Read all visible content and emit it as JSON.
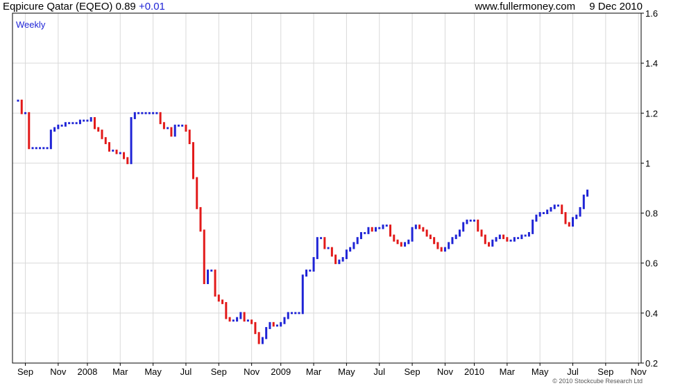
{
  "header": {
    "title": "Eqpicure Qatar (EQEO)",
    "last": "0.89",
    "change": "+0.01",
    "site": "www.fullermoney.com",
    "date": "9 Dec 2010"
  },
  "footer": {
    "copyright": "© 2010 Stockcube Research Ltd"
  },
  "colors": {
    "up": "#1f24d6",
    "down": "#e21a1a",
    "grid": "#d9d9d9",
    "frame": "#000000"
  },
  "chart_data": {
    "type": "bar",
    "subtype": "ohlc-weekly",
    "period_label": "Weekly",
    "grid": true,
    "ylim": [
      0.2,
      1.6
    ],
    "y_axis_side": "right",
    "y_ticks": [
      {
        "value": 0.2,
        "label": "0.2"
      },
      {
        "value": 0.4,
        "label": "0.4"
      },
      {
        "value": 0.6,
        "label": "0.6"
      },
      {
        "value": 0.8,
        "label": "0.8"
      },
      {
        "value": 1.0,
        "label": "1"
      },
      {
        "value": 1.2,
        "label": "1.2"
      },
      {
        "value": 1.4,
        "label": "1.4"
      },
      {
        "value": 1.6,
        "label": "1.6"
      }
    ],
    "x_ticks": [
      {
        "label": "Sep",
        "week": 2
      },
      {
        "label": "Nov",
        "week": 11
      },
      {
        "label": "2008",
        "week": 19
      },
      {
        "label": "Mar",
        "week": 28
      },
      {
        "label": "May",
        "week": 37
      },
      {
        "label": "Jul",
        "week": 46
      },
      {
        "label": "Sep",
        "week": 55
      },
      {
        "label": "Nov",
        "week": 64
      },
      {
        "label": "2009",
        "week": 72
      },
      {
        "label": "Mar",
        "week": 81
      },
      {
        "label": "May",
        "week": 90
      },
      {
        "label": "Jul",
        "week": 99
      },
      {
        "label": "Sep",
        "week": 108
      },
      {
        "label": "Nov",
        "week": 117
      },
      {
        "label": "2010",
        "week": 125
      },
      {
        "label": "Mar",
        "week": 134
      },
      {
        "label": "May",
        "week": 143
      },
      {
        "label": "Jul",
        "week": 152
      },
      {
        "label": "Sep",
        "week": 161
      },
      {
        "label": "Nov",
        "week": 170
      }
    ],
    "closes": [
      1.25,
      1.2,
      1.2,
      1.06,
      1.06,
      1.06,
      1.06,
      1.06,
      1.06,
      1.13,
      1.14,
      1.15,
      1.15,
      1.16,
      1.16,
      1.16,
      1.16,
      1.17,
      1.17,
      1.17,
      1.18,
      1.14,
      1.13,
      1.1,
      1.08,
      1.05,
      1.05,
      1.04,
      1.04,
      1.02,
      1.0,
      1.18,
      1.2,
      1.2,
      1.2,
      1.2,
      1.2,
      1.2,
      1.2,
      1.16,
      1.14,
      1.14,
      1.11,
      1.15,
      1.15,
      1.15,
      1.13,
      1.08,
      0.94,
      0.82,
      0.73,
      0.52,
      0.57,
      0.57,
      0.47,
      0.45,
      0.44,
      0.38,
      0.37,
      0.37,
      0.38,
      0.4,
      0.37,
      0.37,
      0.36,
      0.32,
      0.28,
      0.3,
      0.34,
      0.36,
      0.35,
      0.35,
      0.36,
      0.38,
      0.4,
      0.4,
      0.4,
      0.4,
      0.55,
      0.57,
      0.57,
      0.62,
      0.7,
      0.7,
      0.66,
      0.66,
      0.63,
      0.6,
      0.61,
      0.62,
      0.65,
      0.66,
      0.68,
      0.7,
      0.72,
      0.72,
      0.74,
      0.73,
      0.74,
      0.74,
      0.75,
      0.75,
      0.71,
      0.69,
      0.68,
      0.67,
      0.68,
      0.69,
      0.74,
      0.75,
      0.74,
      0.73,
      0.71,
      0.7,
      0.68,
      0.66,
      0.65,
      0.66,
      0.68,
      0.7,
      0.71,
      0.73,
      0.76,
      0.77,
      0.77,
      0.77,
      0.73,
      0.71,
      0.68,
      0.67,
      0.69,
      0.7,
      0.71,
      0.7,
      0.69,
      0.69,
      0.7,
      0.7,
      0.71,
      0.71,
      0.72,
      0.77,
      0.79,
      0.8,
      0.8,
      0.81,
      0.82,
      0.83,
      0.83,
      0.8,
      0.76,
      0.75,
      0.78,
      0.79,
      0.82,
      0.87,
      0.89
    ]
  }
}
